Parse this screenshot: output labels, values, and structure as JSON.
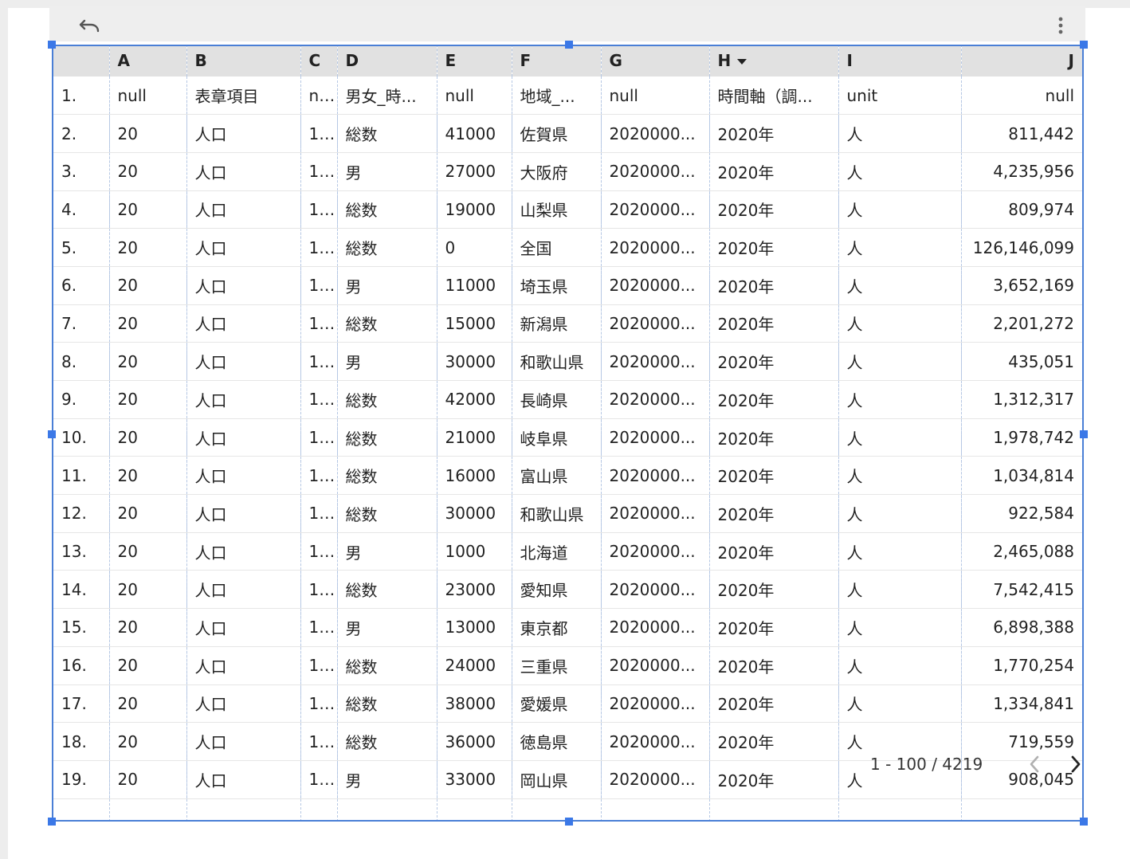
{
  "toolbar": {
    "undo_icon": "undo-icon",
    "more_icon": "more-vert-icon"
  },
  "table": {
    "columns": [
      "",
      "A",
      "B",
      "C",
      "D",
      "E",
      "F",
      "G",
      "H",
      "I",
      "J"
    ],
    "sort_column": "H",
    "rows": [
      [
        "1.",
        "null",
        "表章項目",
        "n...",
        "男女_時...",
        "null",
        "地域_...",
        "null",
        "時間軸（調...",
        "unit",
        "null"
      ],
      [
        "2.",
        "20",
        "人口",
        "1...",
        "総数",
        "41000",
        "佐賀県",
        "2020000...",
        "2020年",
        "人",
        "811,442"
      ],
      [
        "3.",
        "20",
        "人口",
        "1...",
        "男",
        "27000",
        "大阪府",
        "2020000...",
        "2020年",
        "人",
        "4,235,956"
      ],
      [
        "4.",
        "20",
        "人口",
        "1...",
        "総数",
        "19000",
        "山梨県",
        "2020000...",
        "2020年",
        "人",
        "809,974"
      ],
      [
        "5.",
        "20",
        "人口",
        "1...",
        "総数",
        "0",
        "全国",
        "2020000...",
        "2020年",
        "人",
        "126,146,099"
      ],
      [
        "6.",
        "20",
        "人口",
        "1...",
        "男",
        "11000",
        "埼玉県",
        "2020000...",
        "2020年",
        "人",
        "3,652,169"
      ],
      [
        "7.",
        "20",
        "人口",
        "1...",
        "総数",
        "15000",
        "新潟県",
        "2020000...",
        "2020年",
        "人",
        "2,201,272"
      ],
      [
        "8.",
        "20",
        "人口",
        "1...",
        "男",
        "30000",
        "和歌山県",
        "2020000...",
        "2020年",
        "人",
        "435,051"
      ],
      [
        "9.",
        "20",
        "人口",
        "1...",
        "総数",
        "42000",
        "長崎県",
        "2020000...",
        "2020年",
        "人",
        "1,312,317"
      ],
      [
        "10.",
        "20",
        "人口",
        "1...",
        "総数",
        "21000",
        "岐阜県",
        "2020000...",
        "2020年",
        "人",
        "1,978,742"
      ],
      [
        "11.",
        "20",
        "人口",
        "1...",
        "総数",
        "16000",
        "富山県",
        "2020000...",
        "2020年",
        "人",
        "1,034,814"
      ],
      [
        "12.",
        "20",
        "人口",
        "1...",
        "総数",
        "30000",
        "和歌山県",
        "2020000...",
        "2020年",
        "人",
        "922,584"
      ],
      [
        "13.",
        "20",
        "人口",
        "1...",
        "男",
        "1000",
        "北海道",
        "2020000...",
        "2020年",
        "人",
        "2,465,088"
      ],
      [
        "14.",
        "20",
        "人口",
        "1...",
        "総数",
        "23000",
        "愛知県",
        "2020000...",
        "2020年",
        "人",
        "7,542,415"
      ],
      [
        "15.",
        "20",
        "人口",
        "1...",
        "男",
        "13000",
        "東京都",
        "2020000...",
        "2020年",
        "人",
        "6,898,388"
      ],
      [
        "16.",
        "20",
        "人口",
        "1...",
        "総数",
        "24000",
        "三重県",
        "2020000...",
        "2020年",
        "人",
        "1,770,254"
      ],
      [
        "17.",
        "20",
        "人口",
        "1...",
        "総数",
        "38000",
        "愛媛県",
        "2020000...",
        "2020年",
        "人",
        "1,334,841"
      ],
      [
        "18.",
        "20",
        "人口",
        "1...",
        "総数",
        "36000",
        "徳島県",
        "2020000...",
        "2020年",
        "人",
        "719,559"
      ],
      [
        "19.",
        "20",
        "人口",
        "1...",
        "男",
        "33000",
        "岡山県",
        "2020000...",
        "2020年",
        "人",
        "908,045"
      ]
    ]
  },
  "pagination": {
    "label": "1 - 100 / 4219",
    "prev_icon": "chevron-left-icon",
    "next_icon": "chevron-right-icon"
  },
  "colors": {
    "selection": "#3b78e7",
    "header_bg": "#e1e1e1",
    "toolbar_bg": "#eeeeee"
  }
}
